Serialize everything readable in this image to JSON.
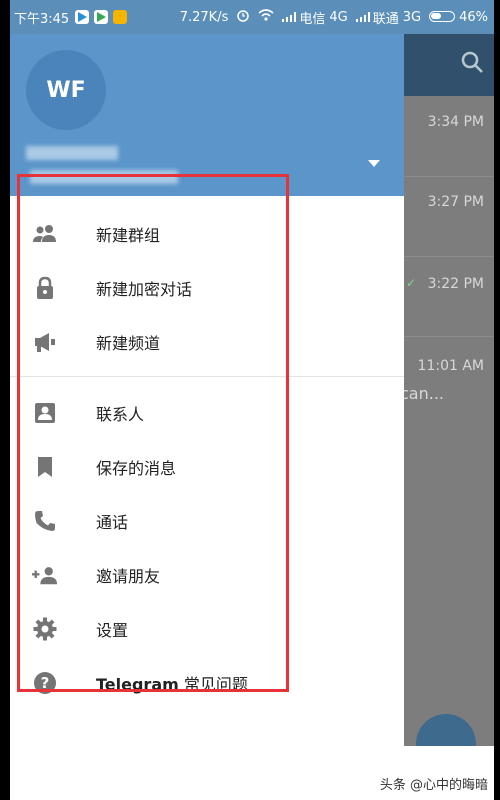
{
  "status_bar": {
    "time": "下午3:45",
    "speed": "7.27K/s",
    "carrier1": "电信",
    "net1": "4G",
    "carrier2": "联通",
    "net2": "3G",
    "battery": "46%"
  },
  "drawer": {
    "avatar_initials": "WF",
    "menu": [
      {
        "label": "新建群组",
        "icon": "group-icon"
      },
      {
        "label": "新建加密对话",
        "icon": "lock-icon"
      },
      {
        "label": "新建频道",
        "icon": "megaphone-icon"
      },
      {
        "label": "联系人",
        "icon": "contact-icon"
      },
      {
        "label": "保存的消息",
        "icon": "bookmark-icon"
      },
      {
        "label": "通话",
        "icon": "phone-icon"
      },
      {
        "label": "邀请朋友",
        "icon": "add-person-icon"
      },
      {
        "label": "设置",
        "icon": "gear-icon"
      },
      {
        "label_brand": "Telegram",
        "label_rest": " 常见问题",
        "icon": "help-icon"
      }
    ]
  },
  "chat_list": {
    "times": [
      "3:34 PM",
      "3:27 PM",
      "3:22 PM",
      "11:01 AM"
    ],
    "snippet": "can..."
  },
  "watermark": "头条 @心中的晦暗",
  "colors": {
    "header": "#5b95c9",
    "highlight": "#e8323a",
    "icon": "#757575"
  }
}
